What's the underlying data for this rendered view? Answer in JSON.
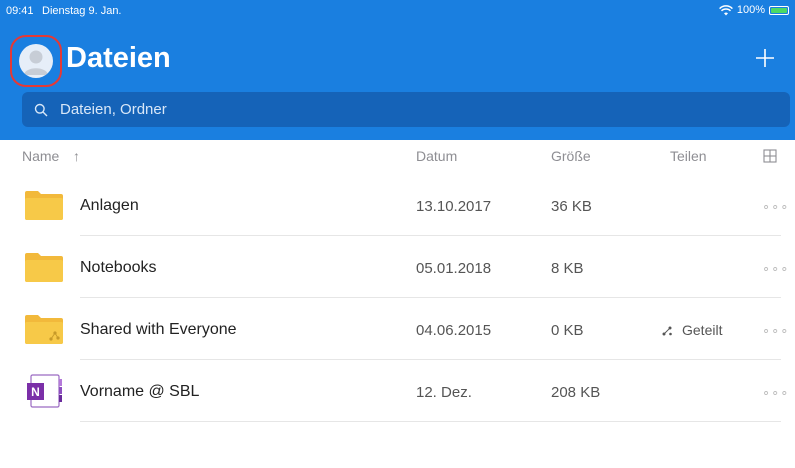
{
  "status_bar": {
    "time": "09:41",
    "date": "Dienstag 9. Jan.",
    "battery": "100%"
  },
  "header": {
    "title": "Dateien"
  },
  "search": {
    "placeholder": "Dateien, Ordner"
  },
  "columns": {
    "name": "Name",
    "sort_arrow": "↑",
    "date": "Datum",
    "size": "Größe",
    "share": "Teilen"
  },
  "files": [
    {
      "name": "Anlagen",
      "date": "13.10.2017",
      "size": "36 KB",
      "share": "",
      "icon": "folder-icon"
    },
    {
      "name": "Notebooks",
      "date": "05.01.2018",
      "size": "8 KB",
      "share": "",
      "icon": "folder-icon"
    },
    {
      "name": "Shared with Everyone",
      "date": "04.06.2015",
      "size": "0 KB",
      "share": "Geteilt",
      "icon": "shared-folder-icon"
    },
    {
      "name": "Vorname @ SBL",
      "date": "12. Dez.",
      "size": "208 KB",
      "share": "",
      "icon": "onenote-icon"
    }
  ],
  "row_more_label": "∘∘∘",
  "colors": {
    "header": "#1a7fe0",
    "search_bg": "#1563b8",
    "avatar_highlight": "#e53935",
    "folder": "#f7c948",
    "onenote": "#7b2fa8"
  }
}
